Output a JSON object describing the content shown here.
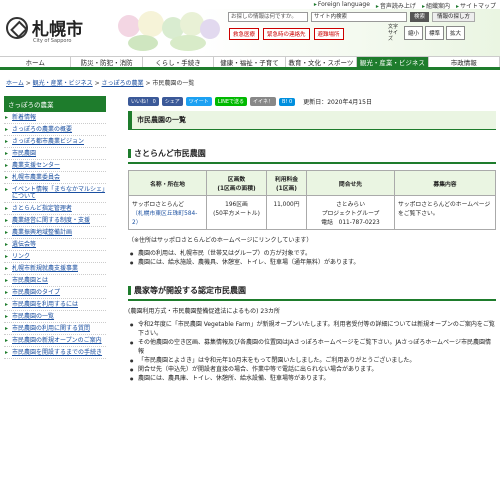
{
  "toplinks": [
    "Foreign language",
    "音声読み上げ",
    "組織案内",
    "サイトマップ"
  ],
  "header": {
    "city_name": "札幌市",
    "city_en": "City of Sapporo",
    "search_placeholder": "お探しの情報は何ですか。",
    "search_scope": "サイト内検索",
    "search_button": "検索",
    "help_button": "情報の探し方",
    "emergency": [
      "救急医療",
      "緊急時の連絡先",
      "避難場所"
    ],
    "size_label": "文字サイズ",
    "size_buttons": [
      "縮小",
      "標準",
      "拡大"
    ]
  },
  "nav": [
    "ホーム",
    "防災・防犯・消防",
    "くらし・手続き",
    "健康・福祉・子育て",
    "教育・文化・スポーツ",
    "観光・産業・ビジネス",
    "市政情報"
  ],
  "nav_active_index": 5,
  "breadcrumb": [
    "ホーム",
    "観光・産業・ビジネス",
    "さっぽろの農業",
    "市民農園の一覧"
  ],
  "sidebar": {
    "title": "さっぽろの農業",
    "items": [
      "新着情報",
      "さっぽろの農業の概要",
      "さっぽろ都市農業ビジョン",
      "市民農園",
      "農業支援センター",
      "札幌市農業委員会",
      "イベント情報「まちなかマルシェ」について",
      "さとらんど指定管理者",
      "農業経営に関する制度・支援",
      "農業振興地域整備計画",
      "遺伝会等",
      "リンク",
      "札幌市新規就農支援事業",
      "市民農園とは",
      "市民農園のタイプ",
      "市民農園を利用するには",
      "市民農園の一覧",
      "市民農園の利用に関する質問",
      "市民農園の新規オープンのご案内",
      "市民農園を開設するまでの手続き"
    ]
  },
  "social": {
    "like": "いいね！ 0",
    "share": "シェア",
    "tweet": "ツイート",
    "line": "LINEで送る",
    "iine": "イイネ！",
    "hatena": "B! 0",
    "updated": "更新日：2020年4月15日"
  },
  "page_title": "市民農園の一覧",
  "section1": {
    "title": "さとらんど市民農園",
    "table_headers": [
      "名称・所在地",
      "区画数\n(1区画の面積)",
      "利用料金\n(1区画)",
      "問合せ先",
      "募集内容"
    ],
    "row": {
      "name": "サッポロさとらんど",
      "address": "（札幌市東区丘珠町584-2）",
      "plots": "196区画\n(50平方メートル)",
      "fee": "11,000円",
      "contact": "さとみらい\nプロジェクトグループ\n電話　011-787-0223",
      "recruit": "サッポロさとらんどのホームページをご覧下さい。"
    },
    "note": "（※住所はサッポロさとらんどのホームページにリンクしています）",
    "bullets": [
      "農園の利用は、札幌市民（世帯又はグループ）の方が対象です。",
      "農園には、給水施設、農機具、休憩室、トイレ、駐車場（通年無料）があります。"
    ]
  },
  "section2": {
    "title": "農家等が開設する認定市民農園",
    "intro": "(農園利用方式・市民農園整備促進法によるもの) 23カ所",
    "bullets": [
      "令和2年度に「市民農園 Vegetable Farm」が新規オープンいたします。利用者受付等の詳細については新規オープンのご案内をご覧下さい。",
      "その他農園の空き区画、募集情報及び各農園の位置図はJAさっぽろホームページをご覧下さい。JAさっぽろホームページ市民農園情報",
      "「市民農園とよさき」は令和元年10月末をもって閉園いたしました。ご利用ありがとうございました。",
      "閑合せ先（申込先）が開設者直接の場合、作業中等で電話に出られない場合があります。",
      "農園には、農具庫、トイレ、休憩所、給水設備、駐車場等があります。"
    ],
    "link_new": "新規オープンのご案内",
    "link_ja": "JAさっぽろホームページ市民農園情報"
  },
  "colors": {
    "green": "#1e7c2c",
    "link": "#1a4fa0",
    "facebook": "#3b5998",
    "twitter": "#1da1f2",
    "line": "#00b900",
    "hatena": "#008fde"
  }
}
